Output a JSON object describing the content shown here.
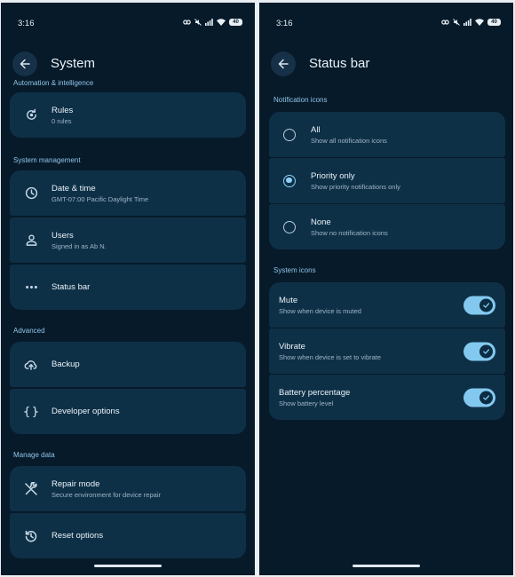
{
  "status_bar": {
    "time": "3:16",
    "battery": "40"
  },
  "left": {
    "title": "System",
    "partial_section": "Automation & intelligence",
    "rules": {
      "title": "Rules",
      "subtitle": "0 rules"
    },
    "system_management": {
      "label": "System management",
      "items": [
        {
          "title": "Date & time",
          "subtitle": "GMT-07:00 Pacific Daylight Time",
          "icon": "clock-icon"
        },
        {
          "title": "Users",
          "subtitle": "Signed in as Ab N.",
          "icon": "person-icon"
        },
        {
          "title": "Status bar",
          "subtitle": "",
          "icon": "more-dots-icon"
        }
      ]
    },
    "advanced": {
      "label": "Advanced",
      "items": [
        {
          "title": "Backup",
          "icon": "cloud-upload-icon"
        },
        {
          "title": "Developer options",
          "icon": "code-braces-icon"
        }
      ]
    },
    "manage_data": {
      "label": "Manage data",
      "items": [
        {
          "title": "Repair mode",
          "subtitle": "Secure environment for device repair",
          "icon": "tools-icon"
        },
        {
          "title": "Reset options",
          "subtitle": "",
          "icon": "history-icon"
        }
      ]
    }
  },
  "right": {
    "title": "Status bar",
    "notification_icons": {
      "label": "Notification icons",
      "options": [
        {
          "title": "All",
          "subtitle": "Show all notification icons",
          "selected": false
        },
        {
          "title": "Priority only",
          "subtitle": "Show priority notifications only",
          "selected": true
        },
        {
          "title": "None",
          "subtitle": "Show no notification icons",
          "selected": false
        }
      ]
    },
    "system_icons": {
      "label": "System icons",
      "items": [
        {
          "title": "Mute",
          "subtitle": "Show when device is muted",
          "on": true
        },
        {
          "title": "Vibrate",
          "subtitle": "Show when device is set to vibrate",
          "on": true
        },
        {
          "title": "Battery percentage",
          "subtitle": "Show battery level",
          "on": true
        }
      ]
    }
  },
  "colors": {
    "background": "#071a29",
    "card": "#0e3047",
    "accent": "#83c9ef",
    "section_label": "#8fc4ea"
  }
}
